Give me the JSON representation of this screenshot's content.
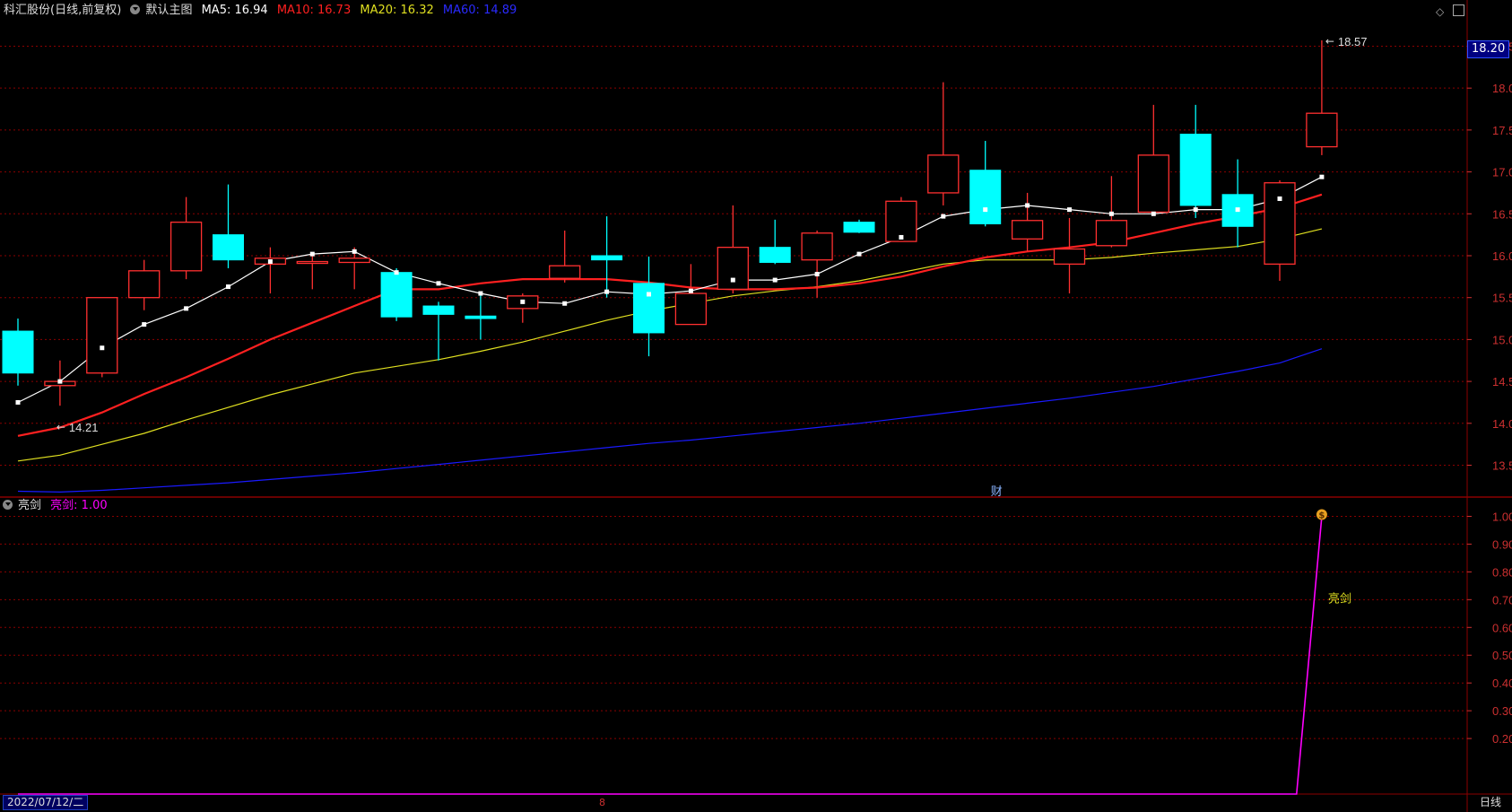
{
  "header": {
    "stock_name": "科汇股份",
    "period_mode": "(日线,前复权)",
    "template": "默认主图",
    "ma5_label": "MA5: 16.94",
    "ma10_label": "MA10: 16.73",
    "ma20_label": "MA20: 16.32",
    "ma60_label": "MA60: 14.89"
  },
  "indicator_header": {
    "name": "亮剑",
    "value_label": "亮剑: 1.00"
  },
  "footer": {
    "date_label": "2022/07/12/二",
    "period_label": "日线",
    "month_marker": "8"
  },
  "price_marker": "18.20",
  "colors": {
    "up": "#ff3030",
    "down": "#00ffff",
    "ma5": "#ffffff",
    "ma10": "#ff2020",
    "ma20": "#e0e020",
    "ma60": "#1a1aff",
    "indicator": "#ff00ff",
    "grid": "#8b0000",
    "axis_label": "#cc3030"
  },
  "chart_data": [
    {
      "type": "candlestick",
      "title": "科汇股份 (日线,前复权)",
      "ylim": [
        13.12,
        18.73
      ],
      "y_ticks": [
        "13.50",
        "14.00",
        "14.50",
        "15.00",
        "15.50",
        "16.00",
        "16.50",
        "17.00",
        "17.50",
        "18.00",
        "18.50"
      ],
      "annotations": {
        "high_label": "18.57",
        "low_label": "14.21",
        "event_marker": "财"
      },
      "candles": [
        {
          "o": 15.1,
          "h": 15.25,
          "l": 14.45,
          "c": 14.6
        },
        {
          "o": 14.45,
          "h": 14.75,
          "l": 14.21,
          "c": 14.5
        },
        {
          "o": 14.6,
          "h": 15.05,
          "l": 14.55,
          "c": 15.5
        },
        {
          "o": 15.5,
          "h": 15.95,
          "l": 15.35,
          "c": 15.82
        },
        {
          "o": 15.82,
          "h": 16.7,
          "l": 15.72,
          "c": 16.4
        },
        {
          "o": 16.25,
          "h": 16.85,
          "l": 15.85,
          "c": 15.95
        },
        {
          "o": 15.9,
          "h": 16.1,
          "l": 15.55,
          "c": 15.97
        },
        {
          "o": 15.92,
          "h": 16.0,
          "l": 15.6,
          "c": 15.93
        },
        {
          "o": 15.92,
          "h": 16.1,
          "l": 15.6,
          "c": 15.97
        },
        {
          "o": 15.8,
          "h": 15.85,
          "l": 15.22,
          "c": 15.27
        },
        {
          "o": 15.4,
          "h": 15.45,
          "l": 14.75,
          "c": 15.3
        },
        {
          "o": 15.28,
          "h": 15.55,
          "l": 15.0,
          "c": 15.25
        },
        {
          "o": 15.37,
          "h": 15.55,
          "l": 15.2,
          "c": 15.52
        },
        {
          "o": 15.73,
          "h": 16.3,
          "l": 15.68,
          "c": 15.88
        },
        {
          "o": 16.0,
          "h": 16.47,
          "l": 15.5,
          "c": 15.95
        },
        {
          "o": 15.67,
          "h": 15.99,
          "l": 14.8,
          "c": 15.08
        },
        {
          "o": 15.18,
          "h": 15.9,
          "l": 15.18,
          "c": 15.55
        },
        {
          "o": 15.6,
          "h": 16.6,
          "l": 15.55,
          "c": 16.1
        },
        {
          "o": 16.1,
          "h": 16.43,
          "l": 15.9,
          "c": 15.92
        },
        {
          "o": 15.95,
          "h": 16.3,
          "l": 15.5,
          "c": 16.27
        },
        {
          "o": 16.4,
          "h": 16.43,
          "l": 16.27,
          "c": 16.28
        },
        {
          "o": 16.17,
          "h": 16.7,
          "l": 16.17,
          "c": 16.65
        },
        {
          "o": 16.75,
          "h": 18.07,
          "l": 16.6,
          "c": 17.2
        },
        {
          "o": 17.02,
          "h": 17.37,
          "l": 16.35,
          "c": 16.38
        },
        {
          "o": 16.2,
          "h": 16.75,
          "l": 16.05,
          "c": 16.42
        },
        {
          "o": 15.9,
          "h": 16.45,
          "l": 15.55,
          "c": 16.08
        },
        {
          "o": 16.12,
          "h": 16.95,
          "l": 16.1,
          "c": 16.42
        },
        {
          "o": 16.52,
          "h": 17.8,
          "l": 16.5,
          "c": 17.2
        },
        {
          "o": 17.45,
          "h": 17.8,
          "l": 16.45,
          "c": 16.6
        },
        {
          "o": 16.73,
          "h": 17.15,
          "l": 16.1,
          "c": 16.35
        },
        {
          "o": 15.9,
          "h": 16.9,
          "l": 15.7,
          "c": 16.87
        },
        {
          "o": 17.3,
          "h": 18.57,
          "l": 17.2,
          "c": 17.7
        }
      ],
      "series": [
        {
          "name": "MA5",
          "values": [
            14.25,
            14.5,
            14.9,
            15.18,
            15.37,
            15.63,
            15.93,
            16.02,
            16.05,
            15.8,
            15.67,
            15.55,
            15.45,
            15.43,
            15.57,
            15.54,
            15.58,
            15.71,
            15.71,
            15.78,
            16.02,
            16.22,
            16.47,
            16.55,
            16.6,
            16.55,
            16.5,
            16.5,
            16.55,
            16.55,
            16.68,
            16.94
          ]
        },
        {
          "name": "MA10",
          "values": [
            13.85,
            13.95,
            14.13,
            14.35,
            14.55,
            14.77,
            15.0,
            15.2,
            15.4,
            15.6,
            15.6,
            15.67,
            15.72,
            15.72,
            15.72,
            15.68,
            15.62,
            15.6,
            15.6,
            15.62,
            15.67,
            15.75,
            15.87,
            15.98,
            16.05,
            16.1,
            16.16,
            16.27,
            16.38,
            16.47,
            16.57,
            16.73
          ]
        },
        {
          "name": "MA20",
          "values": [
            13.55,
            13.62,
            13.75,
            13.88,
            14.04,
            14.19,
            14.34,
            14.47,
            14.6,
            14.68,
            14.76,
            14.86,
            14.97,
            15.1,
            15.23,
            15.34,
            15.43,
            15.52,
            15.58,
            15.63,
            15.7,
            15.8,
            15.9,
            15.95,
            15.95,
            15.95,
            15.98,
            16.03,
            16.07,
            16.11,
            16.2,
            16.32
          ]
        },
        {
          "name": "MA60",
          "values": [
            13.19,
            13.18,
            13.2,
            13.23,
            13.26,
            13.29,
            13.33,
            13.37,
            13.41,
            13.46,
            13.51,
            13.56,
            13.61,
            13.66,
            13.71,
            13.76,
            13.8,
            13.85,
            13.9,
            13.95,
            14.0,
            14.06,
            14.12,
            14.18,
            14.24,
            14.3,
            14.37,
            14.44,
            14.53,
            14.62,
            14.72,
            14.89
          ]
        }
      ]
    },
    {
      "type": "line",
      "title": "亮剑",
      "ylim": [
        0.0,
        1.05
      ],
      "y_ticks": [
        "0.20",
        "0.30",
        "0.40",
        "0.50",
        "0.60",
        "0.70",
        "0.80",
        "0.90",
        "1.00"
      ],
      "annotations": {
        "signal_label": "亮剑"
      },
      "series": [
        {
          "name": "亮剑",
          "values": [
            0,
            0,
            0,
            0,
            0,
            0,
            0,
            0,
            0,
            0,
            0,
            0,
            0,
            0,
            0,
            0,
            0,
            0,
            0,
            0,
            0,
            0,
            0,
            0,
            0,
            0,
            0,
            0,
            0,
            0,
            0,
            1.0
          ]
        }
      ],
      "x_points": [
        0,
        1,
        2,
        3,
        4,
        5,
        6,
        7,
        8,
        9,
        10,
        11,
        12,
        13,
        14,
        15,
        16,
        17,
        18,
        19,
        20,
        21,
        22,
        23,
        24,
        25,
        26,
        27,
        28,
        29,
        30.4,
        31
      ]
    }
  ]
}
